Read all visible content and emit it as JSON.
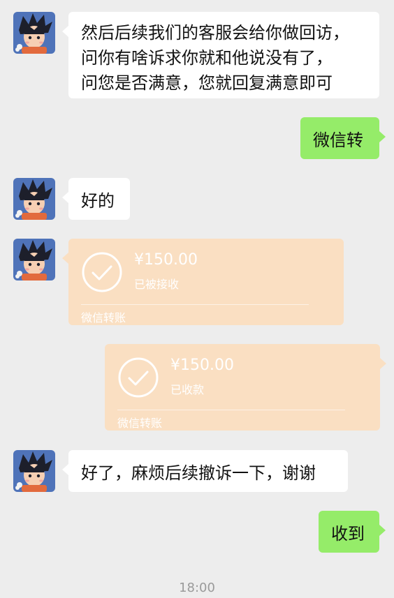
{
  "messages": [
    {
      "side": "left",
      "type": "text",
      "lines": [
        "然后后续我们的客服会给你做回访，",
        "问你有啥诉求你就和他说没有了，",
        "问您是否满意，您就回复满意即可"
      ]
    },
    {
      "side": "right",
      "type": "text",
      "text": "微信转"
    },
    {
      "side": "left",
      "type": "text",
      "text": "好的"
    },
    {
      "side": "left",
      "type": "transfer",
      "amount": "¥150.00",
      "status": "已被接收",
      "footer": "微信转账"
    },
    {
      "side": "right",
      "type": "transfer",
      "amount": "¥150.00",
      "status": "已收款",
      "footer": "微信转账"
    },
    {
      "side": "left",
      "type": "text",
      "text": "好了，麻烦后续撤诉一下，谢谢"
    },
    {
      "side": "right",
      "type": "text",
      "text": "收到"
    }
  ],
  "timestamp": "18:00",
  "colors": {
    "background": "#ededed",
    "bubble_left": "#ffffff",
    "bubble_right": "#95ec69",
    "transfer_card": "#fadfc2",
    "timestamp_text": "#9a9a9a"
  },
  "icons": {
    "avatar": "cartoon-boy-avatar",
    "transfer_status": "check-circle-icon"
  }
}
